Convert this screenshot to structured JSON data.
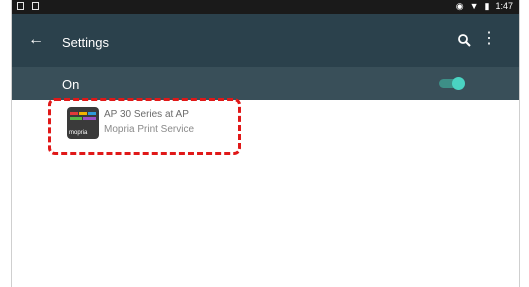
{
  "status_bar": {
    "time": "1:47"
  },
  "toolbar": {
    "back_icon": "arrow-back-icon",
    "title": "Settings",
    "search_icon": "search-icon",
    "more_icon": "more-vert-icon"
  },
  "switch_row": {
    "label": "On",
    "state": "on"
  },
  "printers": [
    {
      "name": "AP 30 Series at AP",
      "service": "Mopria Print Service",
      "icon_text": "mopria"
    }
  ],
  "colors": {
    "toolbar": "#2b414c",
    "switch_row": "#394f59",
    "switch_accent": "#4ad3c2",
    "annotation": "#e01818"
  }
}
